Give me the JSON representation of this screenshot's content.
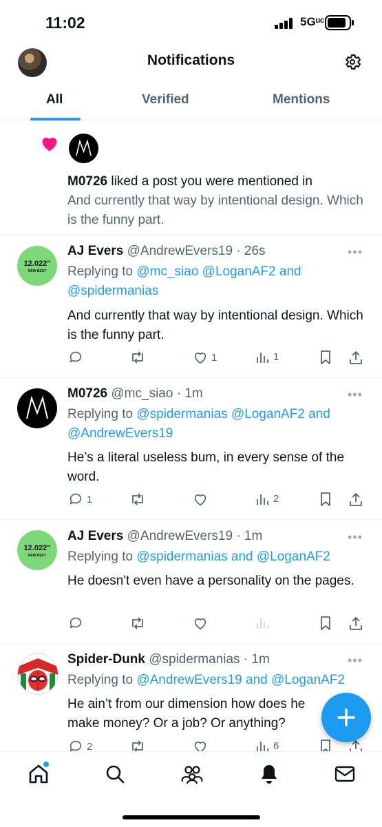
{
  "status_bar": {
    "time": "11:02",
    "network": "5Gᵘᶜ"
  },
  "header": {
    "title": "Notifications"
  },
  "tabs": [
    {
      "label": "All",
      "active": true
    },
    {
      "label": "Verified",
      "active": false
    },
    {
      "label": "Mentions",
      "active": false
    }
  ],
  "like_notification": {
    "actor": "M0726",
    "action": " liked a post you were mentioned in",
    "quote": "And currently that way by intentional design. Which is the funny part."
  },
  "tweets": [
    {
      "name": "AJ Evers",
      "handle": "@AndrewEvers19 · 26s",
      "avatar_text": "12.022\"",
      "avatar_sub": "NEW BEST",
      "reply_prefix": "Replying to ",
      "reply_links": "@mc_siao @LoganAF2 and @spidermanias",
      "text": "And currently that way by intentional design. Which is the funny part.",
      "reply_count": "",
      "retweet_count": "",
      "like_count": "1",
      "views": "1"
    },
    {
      "name": "M0726",
      "handle": "@mc_siao · 1m",
      "reply_prefix": "Replying to ",
      "reply_links": "@spidermanias @LoganAF2 and @AndrewEvers19",
      "text": "He’s a literal useless bum, in every sense of the word.",
      "reply_count": "1",
      "retweet_count": "",
      "like_count": "",
      "views": "2"
    },
    {
      "name": "AJ Evers",
      "handle": "@AndrewEvers19 · 1m",
      "avatar_text": "12.022\"",
      "avatar_sub": "NEW BEST",
      "reply_prefix": "Replying to ",
      "reply_links": "@spidermanias and @LoganAF2",
      "text": "He doesn't even have a personality on the pages.",
      "reply_count": "",
      "retweet_count": "",
      "like_count": "",
      "views": ""
    },
    {
      "name": "Spider-Dunk",
      "handle": "@spidermanias · 1m",
      "reply_prefix": "Replying to ",
      "reply_links": "@AndrewEvers19 and @LoganAF2",
      "text": "He ain’t from our dimension how does he make money? Or a job? Or anything?",
      "reply_count": "2",
      "retweet_count": "",
      "like_count": "",
      "views": "6"
    }
  ],
  "more_label": "•••",
  "colors": {
    "accent": "#1d9bf0",
    "like": "#f91880",
    "avatar_green": "#7ed87a"
  },
  "icons": [
    "heart-icon",
    "gear-icon",
    "reply-icon",
    "retweet-icon",
    "like-icon",
    "views-icon",
    "bookmark-icon",
    "share-icon",
    "home-icon",
    "search-icon",
    "communities-icon",
    "bell-icon",
    "mail-icon",
    "plus-icon"
  ]
}
